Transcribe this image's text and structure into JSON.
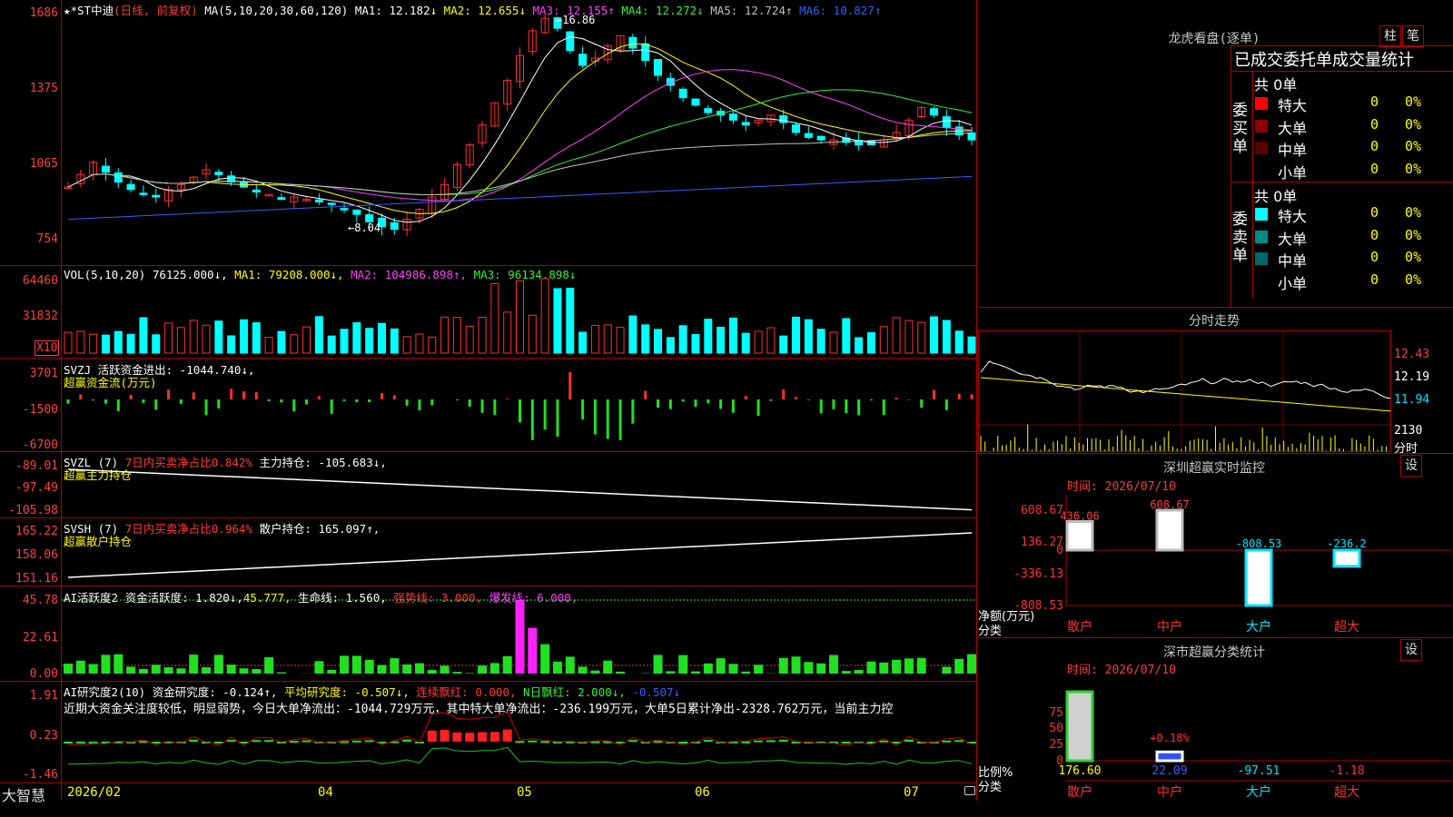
{
  "main": {
    "title": "★*ST中迪",
    "period": "(日线, 前复权)",
    "ma_header": "MA(5,10,20,30,60,120)",
    "ma_values": [
      {
        "label": "MA1: 12.182↓",
        "color": "#ffffff"
      },
      {
        "label": "MA2: 12.655↓",
        "color": "#ffff00"
      },
      {
        "label": "MA3: 12.155↑",
        "color": "#ff40ff"
      },
      {
        "label": "MA4: 12.272↓",
        "color": "#35f035"
      },
      {
        "label": "MA5: 12.724↑",
        "color": "#c0c0c0"
      },
      {
        "label": "MA6: 10.827↑",
        "color": "#3060ff"
      }
    ],
    "y_ticks": [
      "1686",
      "1375",
      "1065",
      "754"
    ],
    "high_label": "16.86",
    "low_label": "8.04",
    "candles": [
      9.9,
      10.4,
      10.9,
      10.5,
      10.1,
      9.8,
      9.6,
      9.5,
      9.8,
      10.0,
      10.3,
      10.6,
      10.4,
      10.1,
      9.9,
      9.7,
      9.6,
      9.4,
      9.5,
      9.4,
      9.3,
      9.2,
      9.0,
      8.8,
      8.5,
      8.3,
      8.2,
      8.6,
      9.0,
      9.5,
      10.0,
      10.8,
      11.6,
      12.4,
      13.3,
      14.2,
      15.2,
      16.2,
      16.7,
      16.3,
      15.4,
      14.8,
      15.1,
      15.6,
      16.0,
      15.5,
      15.0,
      14.4,
      14.0,
      13.5,
      13.2,
      12.9,
      12.8,
      12.6,
      12.4,
      12.6,
      12.8,
      12.5,
      12.1,
      11.9,
      11.8,
      11.8,
      11.7,
      11.6,
      11.6,
      11.8,
      12.1,
      12.6,
      13.1,
      12.8,
      12.3,
      12.0,
      11.8
    ]
  },
  "vol": {
    "header": "VOL(5,10,20)",
    "values": [
      {
        "label": "76125.000↓,",
        "color": "#ffffff"
      },
      {
        "label": "MA1: 79208.000↓,",
        "color": "#ffff00"
      },
      {
        "label": "MA2: 104986.898↑,",
        "color": "#ff40ff"
      },
      {
        "label": "MA3: 96134.898↓",
        "color": "#35f035"
      }
    ],
    "y_ticks": [
      "64460",
      "31832"
    ],
    "unit": "X10"
  },
  "svzj": {
    "header": "SVZJ  活跃资金进出: -1044.740↓,",
    "sub": "超赢资金流(万元)",
    "y_ticks": [
      "3701",
      "-1500",
      "-6700"
    ]
  },
  "svzl": {
    "header": "SVZL (7)",
    "ratio": "7日内买卖净占比0.842%",
    "hold": "主力持仓: -105.683↓,",
    "sub": "超赢主力持仓",
    "y_ticks": [
      "-89.01",
      "-97.49",
      "-105.98"
    ]
  },
  "svsh": {
    "header": "SVSH (7)",
    "ratio": "7日内买卖净占比0.964%",
    "hold": "散户持仓: 165.097↑,",
    "sub": "超赢散户持仓",
    "y_ticks": [
      "165.22",
      "158.06",
      "151.16"
    ]
  },
  "ai1": {
    "header": "AI活跃度2 资金活跃度: 1.820↓,",
    "v2": "45.777,",
    "v3": "生命线: 1.560,",
    "v4": "强势线: 3.000,",
    "v5": "爆发线: 6.000,",
    "y_ticks": [
      "45.78",
      "22.61",
      "0.00"
    ]
  },
  "ai2": {
    "header": "AI研究度2(10) 资金研究度: -0.124↑,",
    "avg": "平均研究度: -0.507↓,",
    "red": "连续飘红: 0.000,",
    "nred": "N日飘红: 2.000↓,",
    "last": "-0.507↓",
    "note": "近期大资金关注度较低，明显弱势，今日大单净流出：-1044.729万元，其中特大单净流出：-236.199万元，大单5日累计净出-2328.762万元，当前主力控",
    "y_ticks": [
      "1.91",
      "0.23",
      "-1.46"
    ]
  },
  "footer": {
    "brand": "大智慧",
    "dates": [
      "2026/02",
      "04",
      "05",
      "06",
      "07"
    ]
  },
  "panel_dragon": {
    "title": "龙虎看盘(逐单)",
    "btn1": "柱",
    "btn2": "笔",
    "subtitle": "已成交委托单成交量统计",
    "buy_label": "委买单",
    "sell_label": "委卖单",
    "buy_total": "共 0单",
    "sell_total": "共 0单",
    "buy_rows": [
      {
        "name": "特大",
        "count": "0",
        "pct": "0%",
        "color": "#ff0000"
      },
      {
        "name": "大单",
        "count": "0",
        "pct": "0%",
        "color": "#8b0000"
      },
      {
        "name": "中单",
        "count": "0",
        "pct": "0%",
        "color": "#5a0000"
      },
      {
        "name": "小单",
        "count": "0",
        "pct": "0%",
        "color": "#000000"
      }
    ],
    "sell_rows": [
      {
        "name": "特大",
        "count": "0",
        "pct": "0%",
        "color": "#00ffff"
      },
      {
        "name": "大单",
        "count": "0",
        "pct": "0%",
        "color": "#008b8b"
      },
      {
        "name": "中单",
        "count": "0",
        "pct": "0%",
        "color": "#006868"
      },
      {
        "name": "小单",
        "count": "0",
        "pct": "0%",
        "color": "#000000"
      }
    ]
  },
  "panel_intraday": {
    "title": "分时走势",
    "y_ticks": [
      "12.43",
      "12.19",
      "11.94"
    ],
    "vol_tick": "2130",
    "unit": "分时"
  },
  "panel_monitor": {
    "title": "深圳超赢实时监控",
    "btn": "设",
    "time": "时间: 2026/07/10",
    "y_ticks": [
      "608.67",
      "136.27",
      "0",
      "-336.13",
      "-808.53"
    ],
    "unit1": "净额(万元)",
    "unit2": "分类",
    "categories": [
      "散户",
      "中户",
      "大户",
      "超大"
    ],
    "values": [
      436.06,
      608.67,
      -808.53,
      -236.2
    ],
    "labels": [
      "436.06",
      "608.67",
      "-808.53",
      "-236.2"
    ]
  },
  "panel_class": {
    "title": "深市超赢分类统计",
    "btn": "设",
    "time": "时间: 2026/07/10",
    "y_ticks": [
      "75",
      "50",
      "25",
      "0"
    ],
    "unit1": "比例%",
    "unit2": "分类",
    "categories": [
      "散户",
      "中户",
      "大户",
      "超大"
    ],
    "bar_labels": [
      "",
      "+0.18%",
      "",
      ""
    ],
    "values": [
      "176.60",
      "22.09",
      "-97.51",
      "-1.18"
    ]
  }
}
